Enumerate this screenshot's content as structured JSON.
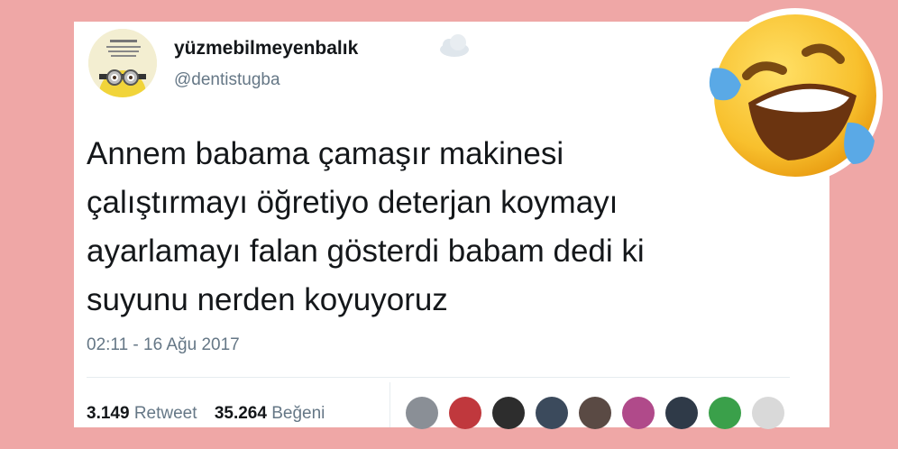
{
  "tweet": {
    "display_name": "yüzmebilmeyenbalık",
    "handle": "@dentistugba",
    "text_lines": [
      "Annem babama çamaşır makinesi",
      "çalıştırmayı öğretiyo deterjan koymayı",
      "ayarlamayı falan gösterdi babam dedi ki",
      "suyunu nerden koyuyoruz"
    ],
    "timestamp": "02:11 - 16 Ağu 2017",
    "retweet_count": "3.149",
    "retweet_label": "Retweet",
    "like_count": "35.264",
    "like_label": "Beğeni"
  },
  "liker_avatar_colors": [
    "#8a8f96",
    "#c0383d",
    "#2d2d2d",
    "#3b4a5c",
    "#5a4a44",
    "#b04a8a",
    "#2f3a48",
    "#3aa04a",
    "#d9d9d9"
  ],
  "colors": {
    "background": "#efa7a6",
    "card": "#ffffff",
    "text": "#14171a",
    "secondary_text": "#657786"
  },
  "icons": {
    "decoration": "laughing-crying-emoji-icon",
    "name_suffix": "cloud-icon"
  }
}
